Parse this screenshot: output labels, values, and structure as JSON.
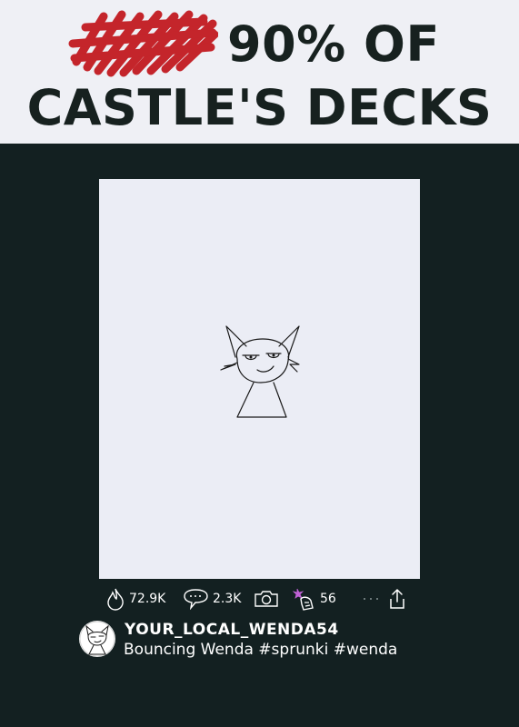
{
  "header": {
    "title_line1": "90% OF",
    "title_line2": "CASTLE'S DECKS",
    "scribble_color": "#c4252b"
  },
  "post": {
    "likes": "72.9K",
    "comments": "2.3K",
    "reposts": "56",
    "username": "YOUR_LOCAL_WENDA54",
    "caption": "Bouncing Wenda #sprunki #wenda"
  },
  "icons": [
    "flame-icon",
    "comment-bubble-icon",
    "camera-icon",
    "repost-icon",
    "more-dots-icon",
    "share-icon"
  ],
  "colors": {
    "background": "#132021",
    "header_bg": "#eff0f5",
    "video_bg": "#ebedf5",
    "title_text": "#17211f"
  }
}
